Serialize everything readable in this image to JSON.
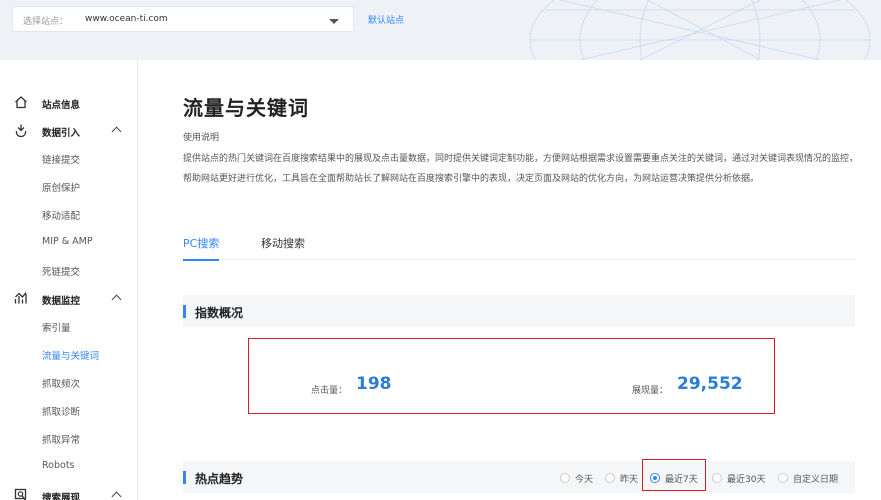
{
  "header": {
    "site_label": "选择站点：",
    "site_value": "www.ocean-ti.com",
    "default_site_link": "默认站点"
  },
  "sidebar": {
    "groups": [
      {
        "label": "站点信息",
        "icon": "home-icon"
      },
      {
        "label": "数据引入",
        "icon": "data-import-icon",
        "items": [
          "链接提交",
          "原创保护",
          "移动适配",
          "MIP & AMP",
          "死链提交"
        ]
      },
      {
        "label": "数据监控",
        "icon": "monitor-chart-icon",
        "items": [
          "索引量",
          "流量与关键词",
          "抓取频次",
          "抓取诊断",
          "抓取异常",
          "Robots"
        ],
        "active_item": "流量与关键词"
      },
      {
        "label": "搜索展现",
        "icon": "search-display-icon"
      }
    ]
  },
  "main": {
    "title": "流量与关键词",
    "usage_title": "使用说明",
    "usage_text": "提供站点的热门关键词在百度搜索结果中的展现及点击量数据，同时提供关键词定制功能，方便网站根据需求设置需要重点关注的关键词，通过对关键词表现情况的监控，帮助网站更好进行优化，工具旨在全面帮助站长了解网站在百度搜索引擎中的表现，决定页面及网站的优化方向，为网站运营决策提供分析依据。",
    "tabs": [
      {
        "label": "PC搜索",
        "active": true
      },
      {
        "label": "移动搜索",
        "active": false
      }
    ],
    "overview": {
      "title": "指数概况",
      "clicks_label": "点击量：",
      "clicks_value": "198",
      "impressions_label": "展现量：",
      "impressions_value": "29,552"
    },
    "trend": {
      "title": "热点趋势",
      "ranges": [
        "今天",
        "昨天",
        "最近7天",
        "最近30天",
        "自定义日期"
      ],
      "selected_range": "最近7天"
    }
  },
  "colors": {
    "accent": "#3385ff",
    "highlight_border": "#d0202a",
    "metric_blue": "#2b7cd3"
  }
}
